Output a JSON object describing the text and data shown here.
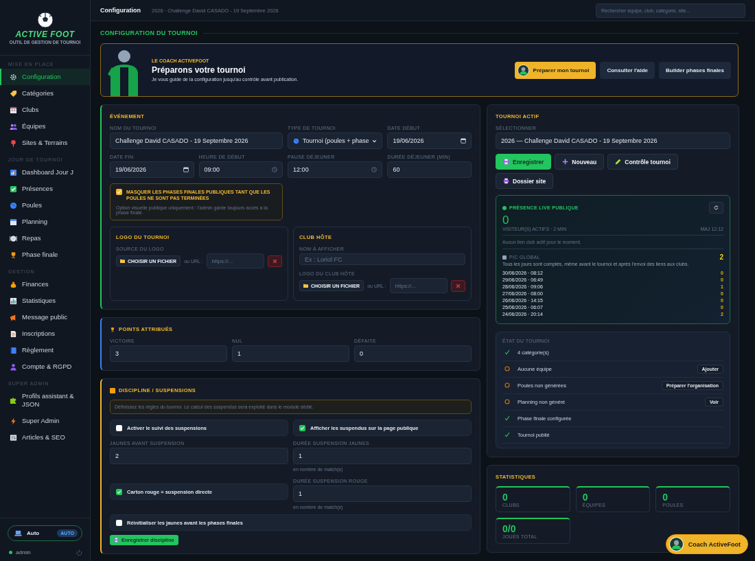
{
  "sidebar": {
    "logo": "ACTIVE FOOT",
    "tagline": "OUTIL DE GESTION DE TOURNOI",
    "sections": [
      {
        "title": "MISE EN PLACE",
        "items": [
          {
            "label": "Configuration",
            "selected": true
          },
          {
            "label": "Catégories",
            "selected": false
          },
          {
            "label": "Clubs",
            "selected": false
          },
          {
            "label": "Équipes",
            "selected": false
          },
          {
            "label": "Sites & Terrains",
            "selected": false
          }
        ]
      },
      {
        "title": "JOUR DE TOURNOI",
        "items": [
          {
            "label": "Dashboard Jour J",
            "selected": false
          },
          {
            "label": "Présences",
            "selected": false
          },
          {
            "label": "Poules",
            "selected": false
          },
          {
            "label": "Planning",
            "selected": false
          },
          {
            "label": "Repas",
            "selected": false
          },
          {
            "label": "Phase finale",
            "selected": false
          }
        ]
      },
      {
        "title": "GESTION",
        "items": [
          {
            "label": "Finances",
            "selected": false
          },
          {
            "label": "Statistiques",
            "selected": false
          },
          {
            "label": "Message public",
            "selected": false
          },
          {
            "label": "Inscriptions",
            "selected": false
          },
          {
            "label": "Règlement",
            "selected": false
          },
          {
            "label": "Compte & RGPD",
            "selected": false
          }
        ]
      },
      {
        "title": "SUPER ADMIN",
        "items": [
          {
            "label": "Profils assistant & JSON",
            "selected": false
          },
          {
            "label": "Super Admin",
            "selected": false
          },
          {
            "label": "Articles & SEO",
            "selected": false
          }
        ]
      }
    ],
    "theme": {
      "label": "Auto",
      "badge": "AUTO",
      "selected": true
    },
    "user": {
      "name": "admin",
      "online": true
    }
  },
  "topbar": {
    "title": "Configuration",
    "subtitle": "2026 · Challenge David CASADO - 19 Septembre 2026",
    "search": {
      "placeholder": "Rechercher équipe, club, catégorie, site..."
    }
  },
  "page_title": "CONFIGURATION DU TOURNOI",
  "coach_banner": {
    "eyebrow": "LE COACH ACTIVEFOOT",
    "title": "Préparons votre tournoi",
    "text": "Je vous guide de la configuration jusqu'au contrôle avant publication.",
    "buttons": [
      {
        "label": "Préparer mon tournoi",
        "kind": "primary"
      },
      {
        "label": "Consulter l'aide",
        "kind": "secondary"
      },
      {
        "label": "Builder phases finales",
        "kind": "secondary"
      }
    ]
  },
  "event": {
    "title": "ÉVÉNEMENT",
    "fields": [
      {
        "label": "NOM DU TOURNOI",
        "value": "Challenge David CASADO - 19 Septembre 2026",
        "kind": "text"
      },
      {
        "label": "TYPE DE TOURNOI",
        "value": "Tournoi (poules + phase",
        "kind": "select"
      },
      {
        "label": "DATE DÉBUT",
        "value": "19/06/2026",
        "kind": "date"
      },
      {
        "label": "DATE FIN",
        "value": "19/06/2026",
        "kind": "date"
      },
      {
        "label": "HEURE DE DÉBUT",
        "value": "09:00",
        "kind": "time"
      },
      {
        "label": "PAUSE DÉJEUNER",
        "value": "12:00",
        "kind": "time"
      },
      {
        "label": "DURÉE DÉJEUNER (MIN)",
        "value": "60",
        "kind": "number"
      }
    ],
    "hide_finals": {
      "checked": true,
      "label": "MASQUER LES PHASES FINALES PUBLIQUES TANT QUE LES POULES NE SONT PAS TERMINÉES",
      "note": "Option visuelle publique uniquement : l'admin garde toujours accès à la phase finale."
    },
    "logo": {
      "title": "LOGO DU TOURNOI",
      "source_label": "SOURCE DU LOGO",
      "file_button": "CHOISIR UN FICHIER",
      "url_label": "ou URL :",
      "url": {
        "placeholder": "https://..."
      }
    },
    "host_club": {
      "title": "CLUB HÔTE",
      "name_label": "NOM À AFFICHER",
      "name": {
        "placeholder": "Ex : Loriol FC"
      },
      "logo_label": "LOGO DU CLUB HÔTE",
      "file_button": "CHOISIR UN FICHIER",
      "url_label": "ou URL :",
      "url": {
        "placeholder": "https://..."
      }
    }
  },
  "points": {
    "title": "POINTS ATTRIBUÉS",
    "fields": [
      {
        "label": "VICTOIRE",
        "value": "3"
      },
      {
        "label": "NUL",
        "value": "1"
      },
      {
        "label": "DÉFAITE",
        "value": "0"
      }
    ]
  },
  "discipline": {
    "title": "DISCIPLINE / SUSPENSIONS",
    "info": "Définissez les règles du tournoi. Le calcul des suspendus sera exploité dans le module dédié.",
    "track_suspensions": {
      "label": "Activer le suivi des suspensions",
      "checked": false
    },
    "show_public": {
      "label": "Afficher les suspendus sur la page publique",
      "checked": true
    },
    "yellow_threshold": {
      "label": "JAUNES AVANT SUSPENSION",
      "value": "2"
    },
    "yellow_duration": {
      "label": "DURÉE SUSPENSION JAUNES",
      "value": "1",
      "hint": "en nombre de match(s)"
    },
    "red_duration": {
      "label": "DURÉE SUSPENSION ROUGE",
      "value": "1",
      "hint": "en nombre de match(s)"
    },
    "red_direct": {
      "label": "Carton rouge = suspension directe",
      "checked": true
    },
    "reset_yellows": {
      "label": "Réinitialiser les jaunes avant les phases finales",
      "checked": false
    },
    "save_button": "Enregistrer discipline"
  },
  "active_tournament": {
    "title": "TOURNOI ACTIF",
    "select_label": "SÉLECTIONNER",
    "select_value": "2026 — Challenge David CASADO - 19 Septembre 2026",
    "buttons": [
      {
        "label": "Enregistrer",
        "kind": "primary"
      },
      {
        "label": "Nouveau",
        "kind": "secondary"
      },
      {
        "label": "Contrôle tournoi",
        "kind": "secondary"
      },
      {
        "label": "Dossier site",
        "kind": "secondary"
      }
    ],
    "presence": {
      "title": "PRÉSENCE LIVE PUBLIQUE",
      "count": "0",
      "caption": "VISITEUR(S) ACTIFS · 2 MIN",
      "updated": "MAJ 12:12",
      "empty": "Aucun lien club actif pour le moment.",
      "peak_label": "PIC GLOBAL",
      "peak_value": "2",
      "note": "Tous les jours sont comptés, même avant le tournoi et après l'envoi des liens aux clubs.",
      "history": [
        {
          "date": "30/06/2026 · 08:12",
          "count": "0"
        },
        {
          "date": "29/06/2026 · 06:49",
          "count": "0"
        },
        {
          "date": "28/06/2026 · 09:06",
          "count": "1"
        },
        {
          "date": "27/06/2026 · 08:00",
          "count": "0"
        },
        {
          "date": "26/06/2026 · 14:15",
          "count": "0"
        },
        {
          "date": "25/06/2026 · 06:07",
          "count": "0"
        },
        {
          "date": "24/06/2026 · 20:14",
          "count": "2"
        }
      ]
    },
    "status": {
      "title": "ÉTAT DU TOURNOI",
      "items": [
        {
          "label": "4 catégorie(s)",
          "done": true
        },
        {
          "label": "Aucune équipe",
          "done": false,
          "action": "Ajouter"
        },
        {
          "label": "Poules non générées",
          "done": false,
          "action": "Préparer l'organisation"
        },
        {
          "label": "Planning non généré",
          "done": false,
          "action": "Voir"
        },
        {
          "label": "Phase finale configurée",
          "done": true
        },
        {
          "label": "Tournoi publié",
          "done": true
        }
      ]
    }
  },
  "stats": {
    "title": "STATISTIQUES",
    "cards": [
      {
        "value": "0",
        "label": "CLUBS"
      },
      {
        "value": "0",
        "label": "ÉQUIPES"
      },
      {
        "value": "0",
        "label": "POULES"
      },
      {
        "value": "0/0",
        "label": "JOUÉS TOTAL"
      }
    ]
  },
  "coach_fab": {
    "label": "Coach ActiveFoot"
  }
}
